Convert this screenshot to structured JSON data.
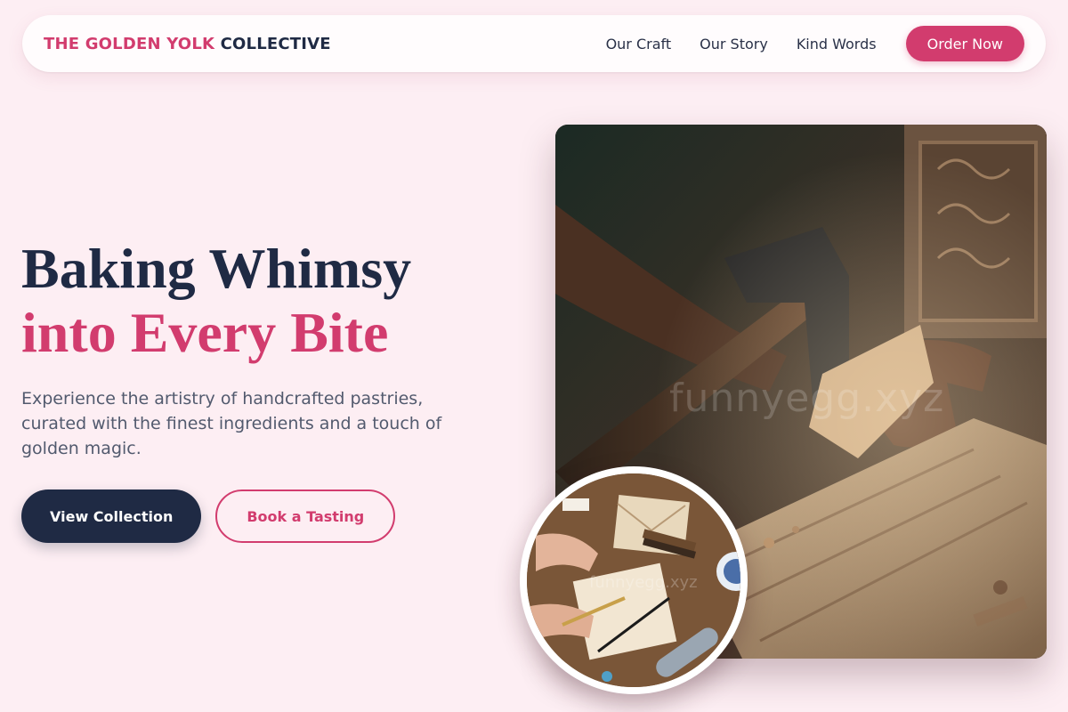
{
  "nav": {
    "brand_accent": "THE GOLDEN YOLK",
    "brand_rest": "COLLECTIVE",
    "links": [
      "Our Craft",
      "Our Story",
      "Kind Words"
    ],
    "order_label": "Order Now"
  },
  "hero": {
    "headline_line1": "Baking Whimsy",
    "headline_line2": "into Every Bite",
    "subtext": "Experience the artistry of handcrafted pastries, curated with the finest ingredients and a touch of golden magic.",
    "primary_cta": "View Collection",
    "secondary_cta": "Book a Tasting"
  },
  "images": {
    "main_watermark": "funnyegg.xyz",
    "circle_watermark": "funnyegg.xyz"
  },
  "colors": {
    "accent": "#d23c6e",
    "dark": "#1f2a44",
    "background": "#fdeef3"
  }
}
